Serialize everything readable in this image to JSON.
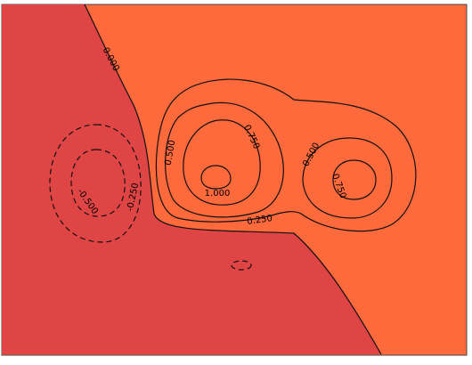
{
  "chart_data": {
    "type": "contour",
    "title": "",
    "xlabel": "",
    "ylabel": "",
    "grid": false,
    "axis_ticks": false,
    "levels": [
      -0.5,
      -0.25,
      0.0,
      0.25,
      0.5,
      0.75,
      1.0
    ],
    "negative_linestyle": "dashed",
    "contour_labels": [
      {
        "level": 0.0,
        "text": "0.000"
      },
      {
        "level": -0.25,
        "text": "-0.250"
      },
      {
        "level": -0.5,
        "text": "-0.500"
      },
      {
        "level": 0.25,
        "text": "0.250"
      },
      {
        "level": 0.5,
        "text": "0.500"
      },
      {
        "level": 0.5,
        "text": "0.500"
      },
      {
        "level": 0.75,
        "text": "0.750"
      },
      {
        "level": 0.75,
        "text": "0.750"
      },
      {
        "level": 1.0,
        "text": "1.000"
      }
    ],
    "fill_colors": {
      "below_-0.5": "#5a3d3f",
      "-0.5_to_-0.25": "#6e4a4a",
      "-0.25_to_0": "#e04545",
      "0_to_0.25": "#ff6a3d",
      "0.25_to_0.5": "#ff9933",
      "0.5_to_0.75": "#ffe04d",
      "0.75_to_1.0": "#ffff88",
      "above_1.0": "#ffffe0"
    },
    "colormap": "hot"
  }
}
